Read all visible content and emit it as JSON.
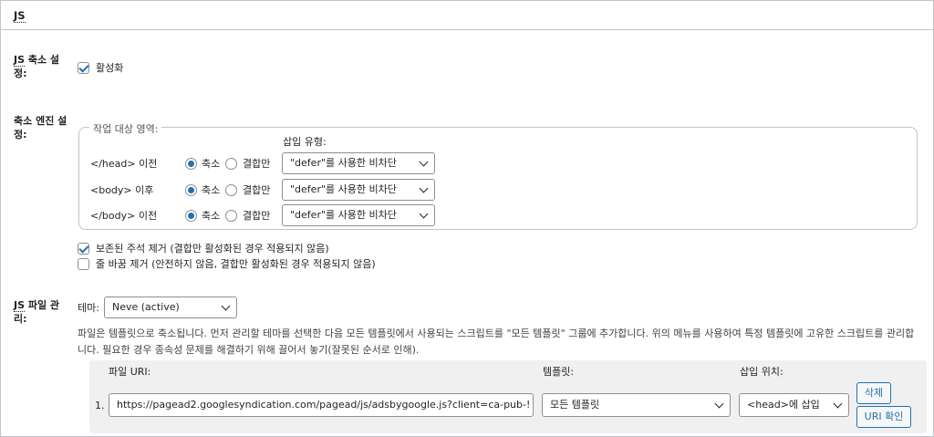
{
  "panel": {
    "title": "JS"
  },
  "minify": {
    "label": "JS 축소 설정:",
    "label_underlined": "JS",
    "label_rest": " 축소 설정:",
    "checkbox_label": "활성화",
    "checked": true
  },
  "engine": {
    "label": "축소 엔진 설정:",
    "legend": "작업 대상 영역:",
    "insert_type_header": "삽입 유형:",
    "rows": [
      {
        "label": "</head> 이전",
        "opt_minify": "축소",
        "opt_combine": "결합만",
        "selected": "minify",
        "insert": "\"defer\"를 사용한 비차단"
      },
      {
        "label": "<body> 이후",
        "opt_minify": "축소",
        "opt_combine": "결합만",
        "selected": "minify",
        "insert": "\"defer\"를 사용한 비차단"
      },
      {
        "label": "</body> 이전",
        "opt_minify": "축소",
        "opt_combine": "결합만",
        "selected": "minify",
        "insert": "\"defer\"를 사용한 비차단"
      }
    ],
    "options": [
      {
        "label": "보존된 주석 제거 (결합만 활성화된 경우 적용되지 않음)",
        "checked": true
      },
      {
        "label": "줄 바꿈 제거 (안전하지 않음, 결합만 활성화된 경우 적용되지 않음)",
        "checked": false
      }
    ]
  },
  "files": {
    "label_underlined": "JS",
    "label_rest": " 파일 관리:",
    "theme_label": "테마:",
    "theme_value": "Neve (active)",
    "description": "파일은 템플릿으로 축소됩니다. 먼저 관리할 테마를 선택한 다음 모든 템플릿에서 사용되는 스크립트를 \"모든 템플릿\" 그룹에 추가합니다. 위의 메뉴를 사용하여 특정 템플릿에 고유한 스크립트를 관리합니다. 필요한 경우 종속성 문제를 해결하기 위해 끌어서 놓기(잘못된 순서로 인해).",
    "col_uri": "파일 URI:",
    "col_template": "템플릿:",
    "col_position": "삽입 위치:",
    "rows": [
      {
        "index": "1.",
        "uri": "https://pagead2.googlesyndication.com/pagead/js/adsbygoogle.js?client=ca-pub-!",
        "template": "모든 템플릿",
        "position": "<head>에 삽입",
        "delete_label": "삭제",
        "verify_label": "URI 확인"
      }
    ]
  },
  "colors": {
    "accent": "#2271b1",
    "border": "#c3c4c7",
    "box_bg": "#f0f0f1"
  }
}
